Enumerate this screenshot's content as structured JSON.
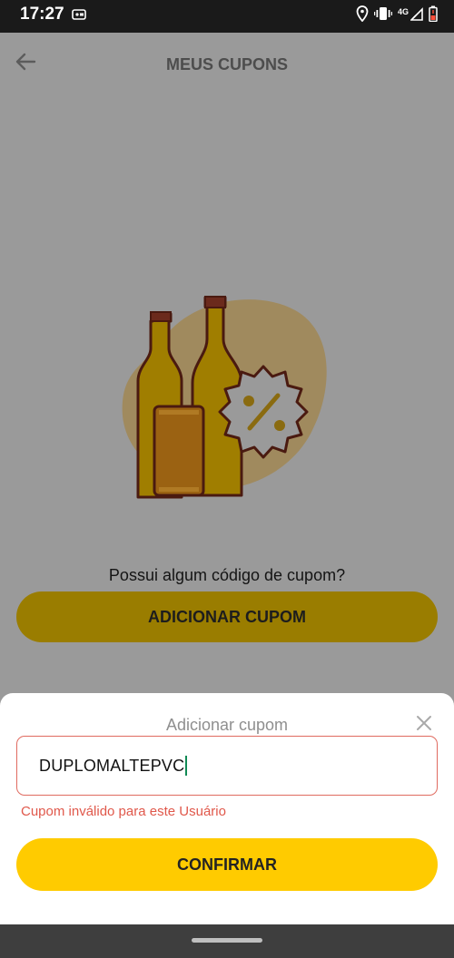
{
  "status_bar": {
    "time": "17:27",
    "network": "4G",
    "icons": [
      "notification-icon",
      "location-icon",
      "vibrate-icon",
      "signal-icon",
      "battery-low-icon"
    ]
  },
  "header": {
    "title": "MEUS CUPONS",
    "back_icon": "arrow-left-icon"
  },
  "main": {
    "prompt": "Possui algum código de cupom?",
    "add_button_label": "ADICIONAR CUPOM",
    "illustration": "bottles-with-discount-badge"
  },
  "sheet": {
    "title": "Adicionar cupom",
    "close_icon": "close-icon",
    "input_value": "DUPLOMALTEPVC",
    "error": "Cupom inválido para este Usuário",
    "confirm_label": "CONFIRMAR"
  },
  "colors": {
    "accent": "#ffcb00",
    "error": "#e0584b",
    "overlay": "#9a9a9a"
  }
}
